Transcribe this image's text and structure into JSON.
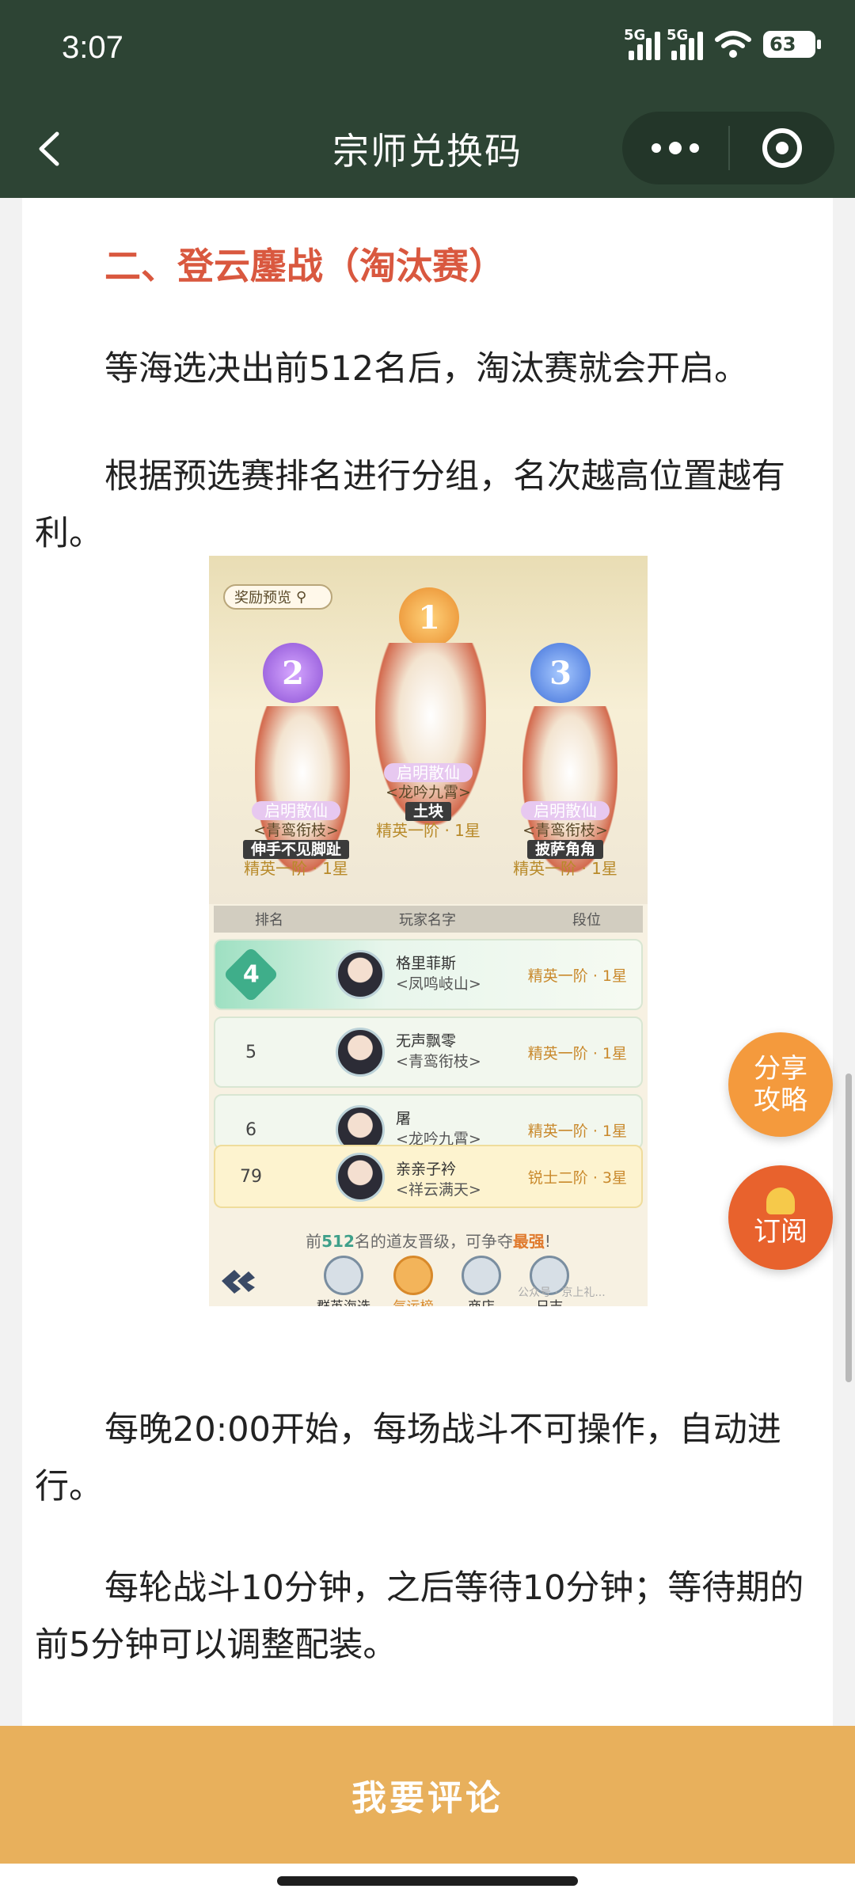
{
  "status": {
    "time": "3:07",
    "sig1": "5G",
    "sig2": "5G",
    "battery": "63"
  },
  "nav": {
    "title": "宗师兑换码"
  },
  "article": {
    "heading": "二、登云鏖战（淘汰赛）",
    "p1": "等海选决出前512名后，淘汰赛就会开启。",
    "p2": "根据预选赛排名进行分组，名次越高位置越有利。",
    "p3": "每晚20:00开始，每场战斗不可操作，自动进行。",
    "p4": "每轮战斗10分钟，之后等待10分钟；等待期的前5分钟可以调整配装。"
  },
  "screenshot": {
    "reward_preview": "奖励预览",
    "podium": [
      {
        "place": "1",
        "title": "启明散仙",
        "guild": "<龙吟九霄>",
        "name": "土块",
        "rank": "精英一阶 · 1星"
      },
      {
        "place": "2",
        "title": "启明散仙",
        "guild": "<青鸾衔枝>",
        "name": "伸手不见脚趾",
        "rank": "精英一阶 · 1星"
      },
      {
        "place": "3",
        "title": "启明散仙",
        "guild": "<青鸾衔枝>",
        "name": "披萨角角",
        "rank": "精英一阶 · 1星"
      }
    ],
    "table_headers": [
      "排名",
      "玩家名字",
      "段位"
    ],
    "rows": [
      {
        "rank": "4",
        "name": "格里菲斯",
        "guild": "<凤鸣岐山>",
        "level": "精英一阶 · 1星"
      },
      {
        "rank": "5",
        "name": "无声飘零",
        "guild": "<青鸾衔枝>",
        "level": "精英一阶 · 1星"
      },
      {
        "rank": "6",
        "name": "屠",
        "guild": "<龙吟九霄>",
        "level": "精英一阶 · 1星"
      },
      {
        "rank": "79",
        "name": "亲亲子衿",
        "guild": "<祥云满天>",
        "level": "锐士二阶 · 3星"
      }
    ],
    "promo_a": "前",
    "promo_num": "512",
    "promo_b": "名的道友晋级，可争夺",
    "promo_c": "最强",
    "promo_d": "!",
    "tabs": [
      "群英海选",
      "气运榜",
      "商店",
      "日志"
    ],
    "watermark": "公众号 · 京上礼..."
  },
  "float": {
    "share": "分享攻略",
    "subscribe": "订阅"
  },
  "comment_button": "我要评论",
  "colors": {
    "nav_bg": "#2d4434",
    "heading": "#d9583f",
    "comment_bar": "#e8b05c",
    "share_btn": "#f49a3d",
    "subscribe_btn": "#e8622d"
  }
}
